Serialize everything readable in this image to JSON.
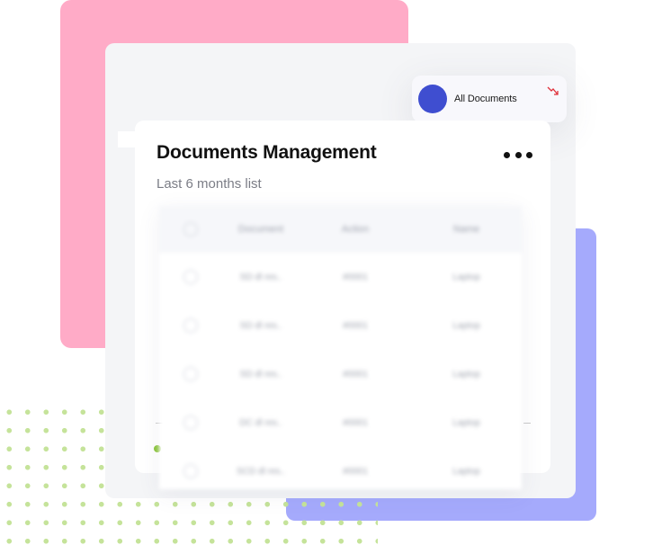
{
  "notification": {
    "label": "All Documents",
    "avatar_color": "#3f4ed0",
    "trend_icon": "trend-down-icon",
    "trend_color": "#e0303a"
  },
  "card": {
    "title": "Documents Management",
    "subtitle": "Last 6 months list",
    "menu_icon": "more-horizontal-icon"
  },
  "table": {
    "headers": [
      "Document",
      "Action",
      "Name"
    ],
    "rows": [
      {
        "document": "SD dl res..",
        "action": "#0001",
        "name": "Laptop"
      },
      {
        "document": "SD dl res..",
        "action": "#0001",
        "name": "Laptop"
      },
      {
        "document": "SD dl res..",
        "action": "#0001",
        "name": "Laptop"
      },
      {
        "document": "DC dl res..",
        "action": "#0001",
        "name": "Laptop"
      },
      {
        "document": "SCD dl res..",
        "action": "#0001",
        "name": "Laptop"
      }
    ]
  },
  "colors": {
    "pink_accent": "#ffabc7",
    "purple_accent": "#a5aafc",
    "dot_green": "#c5e39a",
    "panel_gray": "#f4f5f7"
  }
}
